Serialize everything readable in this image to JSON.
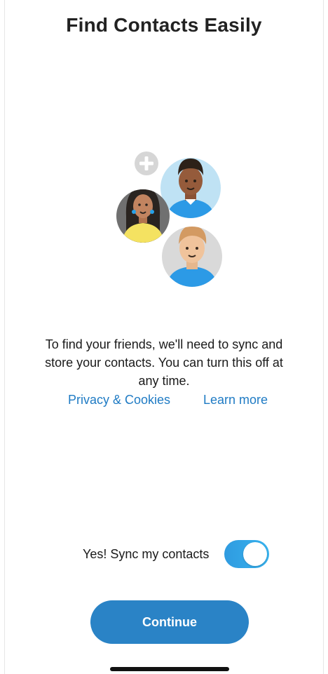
{
  "header": {
    "title": "Find Contacts Easily"
  },
  "illustration": {
    "icons": [
      "add-contact-icon",
      "person-avatar-icon",
      "person-avatar-icon",
      "person-avatar-icon"
    ]
  },
  "body": {
    "description": "To find your friends, we'll need to sync and store your contacts. You can turn this off at any time."
  },
  "links": {
    "privacy": "Privacy & Cookies",
    "learn_more": "Learn more"
  },
  "sync": {
    "label": "Yes! Sync my contacts",
    "enabled": true
  },
  "actions": {
    "continue_label": "Continue"
  },
  "colors": {
    "accent": "#2a83c6",
    "link": "#1f7bc4",
    "toggle_on": "#2f9be0"
  }
}
